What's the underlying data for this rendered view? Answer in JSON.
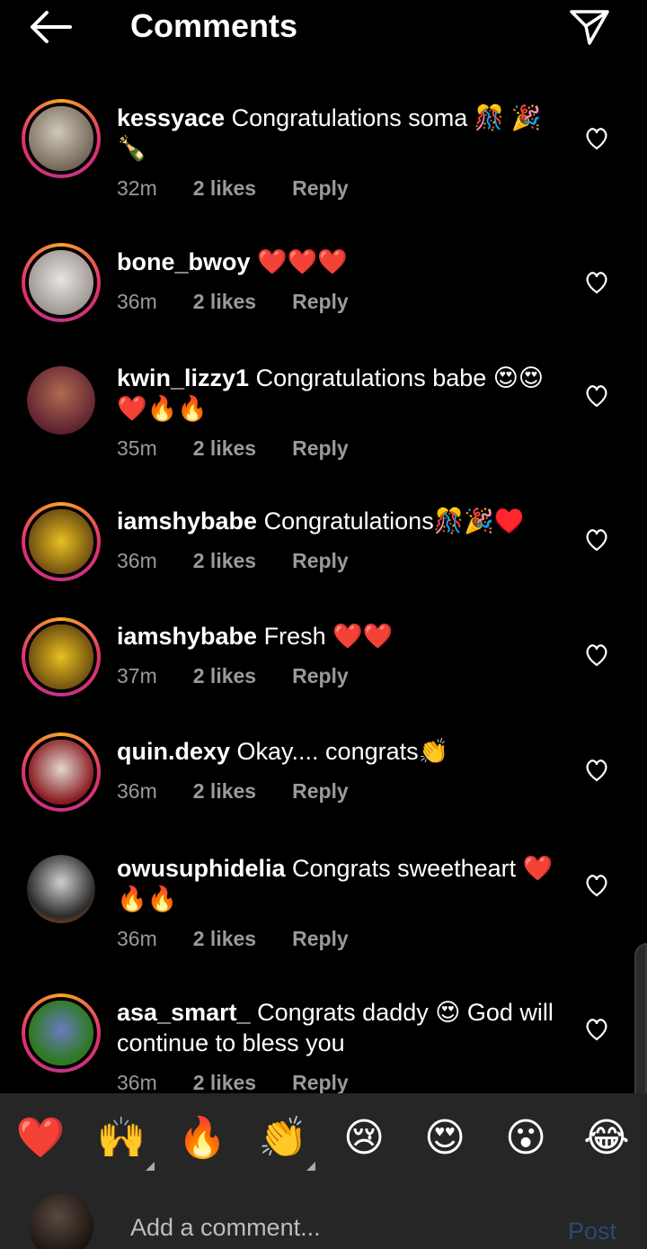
{
  "header": {
    "title": "Comments",
    "back_icon": "arrow-left-icon",
    "share_icon": "send-icon"
  },
  "comments": [
    {
      "username": "kessyace",
      "text": " Congratulations soma 🎊 🎉 🍾",
      "time": "32m",
      "likes": "2 likes",
      "reply": "Reply",
      "ring": true,
      "avatar_color": "#7a6a55"
    },
    {
      "username": "bone_bwoy",
      "text": " ❤️❤️❤️",
      "time": "36m",
      "likes": "2 likes",
      "reply": "Reply",
      "ring": true,
      "avatar_color": "#c9c3c0"
    },
    {
      "username": "kwin_lizzy1",
      "text": " Congratulations babe 😍😍 ❤️🔥🔥",
      "time": "35m",
      "likes": "2 likes",
      "reply": "Reply",
      "ring": false,
      "avatar_color": "#8a3a4a"
    },
    {
      "username": "iamshybabe",
      "text": " Congratulations🎊🎉♥️",
      "time": "36m",
      "likes": "2 likes",
      "reply": "Reply",
      "ring": true,
      "avatar_color": "#c9a020"
    },
    {
      "username": "iamshybabe",
      "text": " Fresh ❤️❤️",
      "time": "37m",
      "likes": "2 likes",
      "reply": "Reply",
      "ring": true,
      "avatar_color": "#c9a020"
    },
    {
      "username": "quin.dexy",
      "text": " Okay.... congrats👏",
      "time": "36m",
      "likes": "2 likes",
      "reply": "Reply",
      "ring": true,
      "avatar_color": "#9a1f24"
    },
    {
      "username": "owusuphidelia",
      "text": " Congrats sweetheart ❤️🔥🔥",
      "time": "36m",
      "likes": "2 likes",
      "reply": "Reply",
      "ring": false,
      "avatar_color": "#4a4a4a"
    },
    {
      "username": "asa_smart_",
      "text": " Congrats daddy 😍 God will continue to bless you",
      "time": "36m",
      "likes": "2 likes",
      "reply": "Reply",
      "ring": true,
      "avatar_color": "#3c8a30"
    }
  ],
  "emoji_bar": [
    "❤️",
    "🙌",
    "🔥",
    "👏",
    "😢",
    "😍",
    "😮",
    "😂"
  ],
  "input": {
    "placeholder": "Add a comment...",
    "post_label": "Post"
  }
}
